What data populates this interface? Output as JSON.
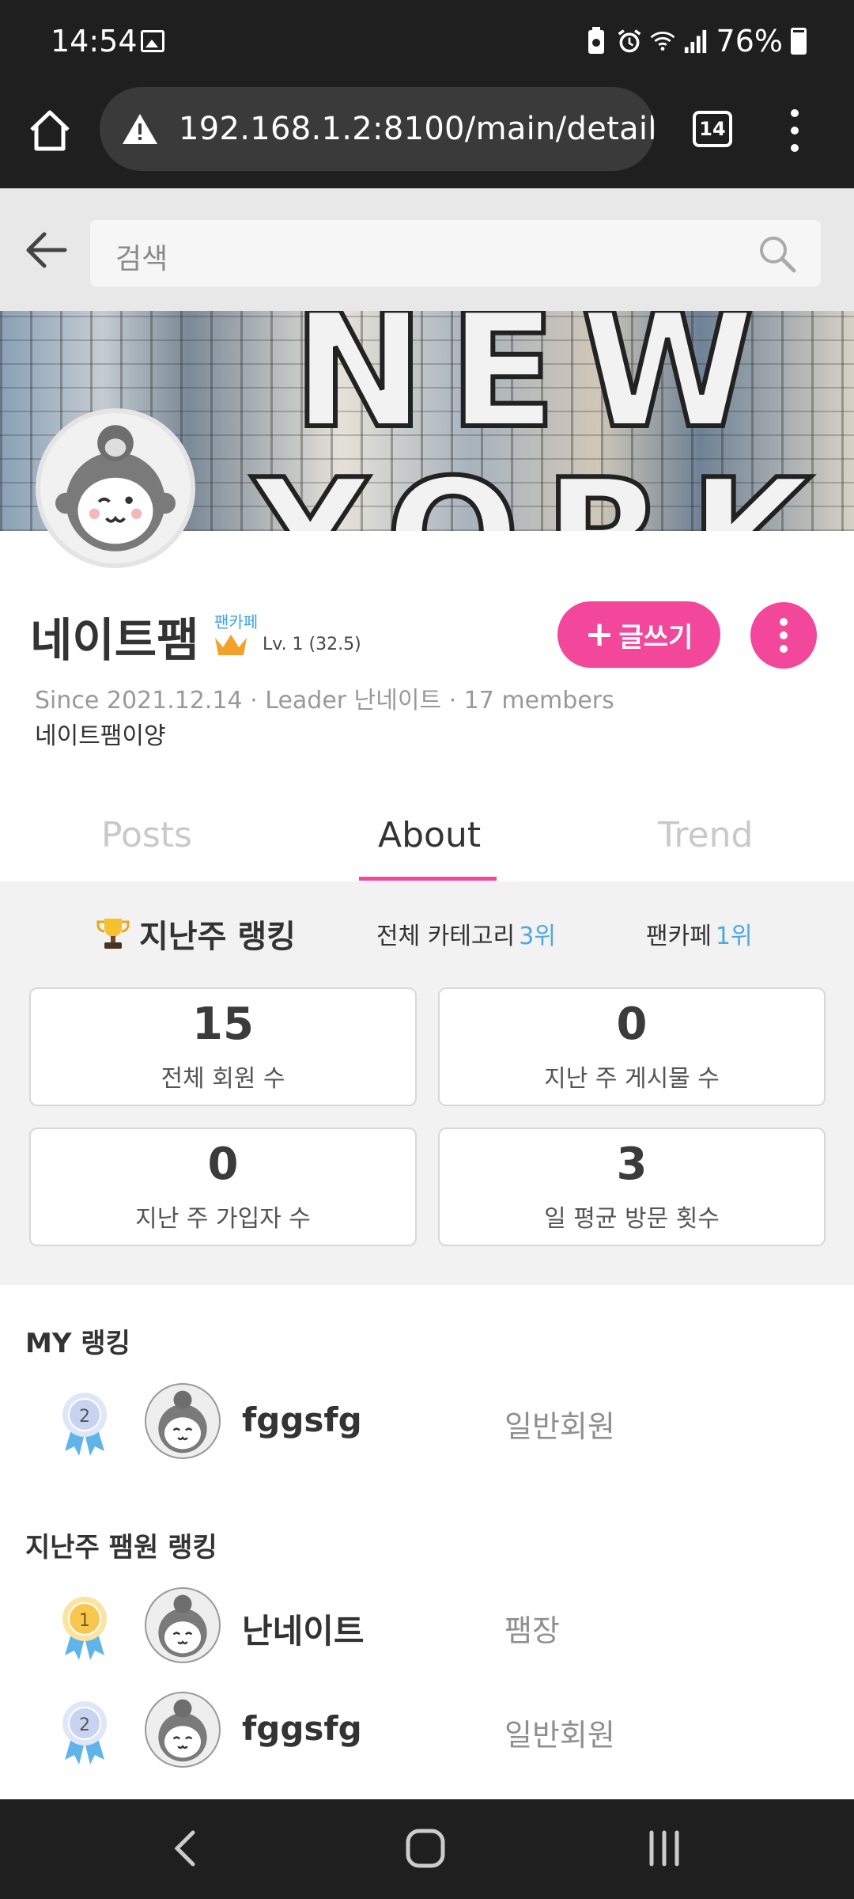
{
  "status_bar": {
    "time": "14:54",
    "battery": "76%",
    "icons": [
      "image-icon",
      "battery-saver-icon",
      "alarm-icon",
      "wifi-icon",
      "signal-icon",
      "battery-icon"
    ]
  },
  "browser": {
    "url": "192.168.1.2:8100/main/detail/",
    "tab_count": "14"
  },
  "search": {
    "placeholder": "검색"
  },
  "profile": {
    "name": "네이트팸",
    "cafe_type": "팬카페",
    "level": "Lv. 1 (32.5)",
    "meta": "Since 2021.12.14 · Leader 난네이트 · 17 members",
    "description": "네이트팸이양",
    "write_button": "글쓰기"
  },
  "tabs": [
    {
      "label": "Posts",
      "active": false
    },
    {
      "label": "About",
      "active": true
    },
    {
      "label": "Trend",
      "active": false
    }
  ],
  "weekly_ranking": {
    "title": "지난주 랭킹",
    "category_label": "전체 카테고리",
    "category_rank": "3위",
    "fancafe_label": "팬카페",
    "fancafe_rank": "1위"
  },
  "stats": [
    {
      "value": "15",
      "label": "전체 회원 수"
    },
    {
      "value": "0",
      "label": "지난 주 게시물 수"
    },
    {
      "value": "0",
      "label": "지난 주 가입자 수"
    },
    {
      "value": "3",
      "label": "일 평균 방문 횟수"
    }
  ],
  "my_ranking": {
    "title": "MY 랭킹",
    "rows": [
      {
        "rank": "2",
        "name": "fggsfg",
        "role": "일반회원"
      }
    ]
  },
  "member_ranking": {
    "title": "지난주 팸원 랭킹",
    "rows": [
      {
        "rank": "1",
        "name": "난네이트",
        "role": "팸장"
      },
      {
        "rank": "2",
        "name": "fggsfg",
        "role": "일반회원"
      }
    ]
  },
  "colors": {
    "accent": "#f2479b",
    "rank_highlight": "#4fa8e0",
    "gold_medal": "#f7c74f",
    "silver_medal": "#c8d3f0",
    "ribbon": "#5fb4ea"
  }
}
